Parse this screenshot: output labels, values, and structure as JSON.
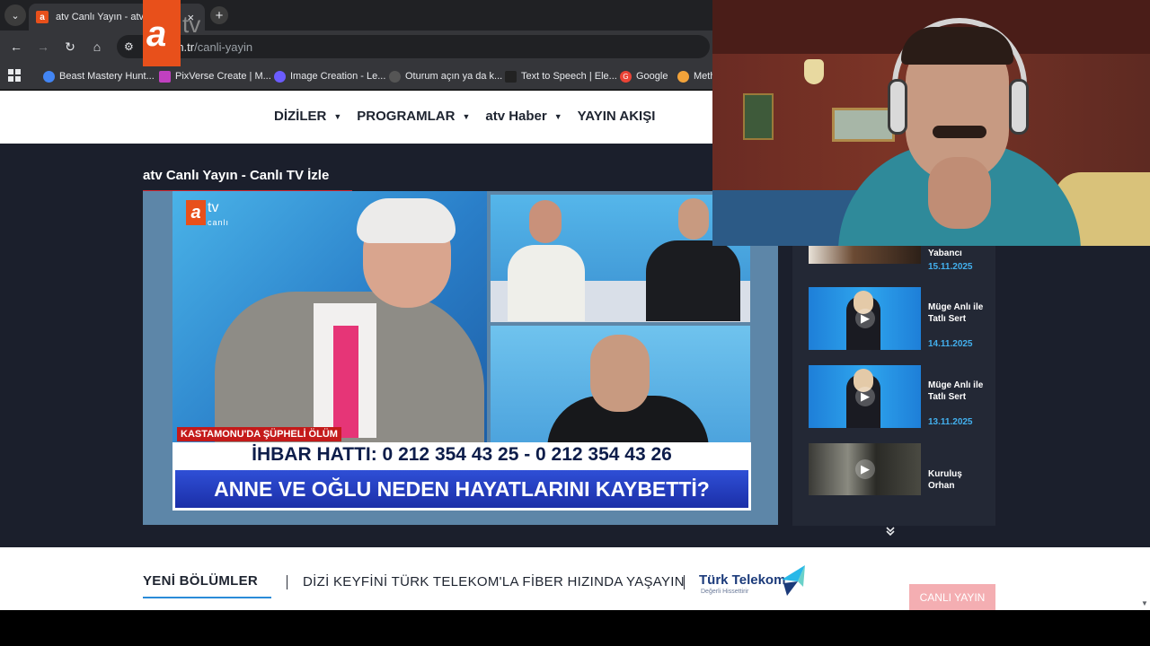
{
  "browser": {
    "tab_title": "atv Canlı Yayın - atv Canlı İzle",
    "tab_close": "×",
    "new_tab": "+",
    "url_host": "atv.com.tr",
    "url_path": "/canli-yayin",
    "bookmarks": [
      {
        "label": "Beast Mastery Hunt...",
        "color": "#4285f4"
      },
      {
        "label": "PixVerse Create | M...",
        "color": "#c040c0"
      },
      {
        "label": "Image Creation - Le...",
        "color": "#6b5cff"
      },
      {
        "label": "Oturum açın ya da k...",
        "color": "#555555"
      },
      {
        "label": "Text to Speech | Ele...",
        "color": "#222222"
      },
      {
        "label": "Google",
        "color": "#ea4335"
      },
      {
        "label": "Meth",
        "color": "#f2a33a"
      }
    ]
  },
  "site": {
    "logo_a": "a",
    "logo_tv": "tv",
    "menu": [
      {
        "label": "DİZİLER",
        "has_dropdown": true
      },
      {
        "label": "PROGRAMLAR",
        "has_dropdown": true
      },
      {
        "label": "atv Haber",
        "has_dropdown": true
      },
      {
        "label": "YAYIN AKIŞI",
        "has_dropdown": false
      }
    ],
    "page_title": "atv Canlı Yayın - Canlı TV İzle",
    "accent_color": "#e8501b"
  },
  "player": {
    "bug_a": "a",
    "bug_tv": "tv",
    "bug_canli": "canlı",
    "news_label": "KASTAMONU'DA ŞÜPHELİ ÖLÜM",
    "ticker_line1": "İHBAR HATTI: 0 212 354 43 25 - 0 212 354 43 26",
    "ticker_line2": "ANNE VE OĞLU NEDEN HAYATLARINI KAYBETTİ?"
  },
  "sidebar": {
    "items": [
      {
        "title": "Yabancı",
        "date": "15.11.2025"
      },
      {
        "title": "Müge Anlı ile Tatlı Sert",
        "date": "14.11.2025"
      },
      {
        "title": "Müge Anlı ile Tatlı Sert",
        "date": "13.11.2025"
      },
      {
        "title": "Kuruluş Orhan",
        "date": ""
      }
    ],
    "play_icon": "▶",
    "scroll_more_icon": "double-chevron-down-icon"
  },
  "bottom": {
    "yeni_bolumler": "YENİ BÖLÜMLER",
    "promo_text": "DİZİ KEYFİNİ TÜRK TELEKOM'LA FİBER HIZINDA YAŞAYIN",
    "telekom_name": "Türk Telekom",
    "telekom_slogan": "Değerli Hissettirir",
    "canli_button": "CANLI YAYIN"
  }
}
